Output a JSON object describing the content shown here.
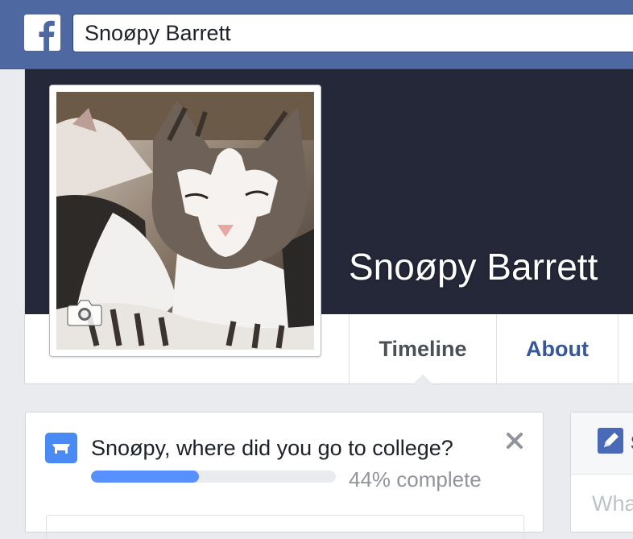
{
  "header": {
    "logo_icon": "facebook-f-icon",
    "search_value": "Snoøpy Barrett",
    "bar_color": "#4e69a2"
  },
  "profile": {
    "name": "Snoøpy Barrett",
    "picture_icon": "camera-icon",
    "cover_color": "#252838"
  },
  "tabs": [
    {
      "label": "Timeline",
      "active": true
    },
    {
      "label": "About",
      "active": false
    }
  ],
  "prompt": {
    "icon": "education-icon",
    "question": "Snoøpy, where did you go to college?",
    "progress_percent": 44,
    "progress_label": "44% complete",
    "close_icon": "close-icon"
  },
  "composer": {
    "icon": "pencil-icon",
    "title_fragment": "S",
    "placeholder_fragment": "Wha"
  }
}
